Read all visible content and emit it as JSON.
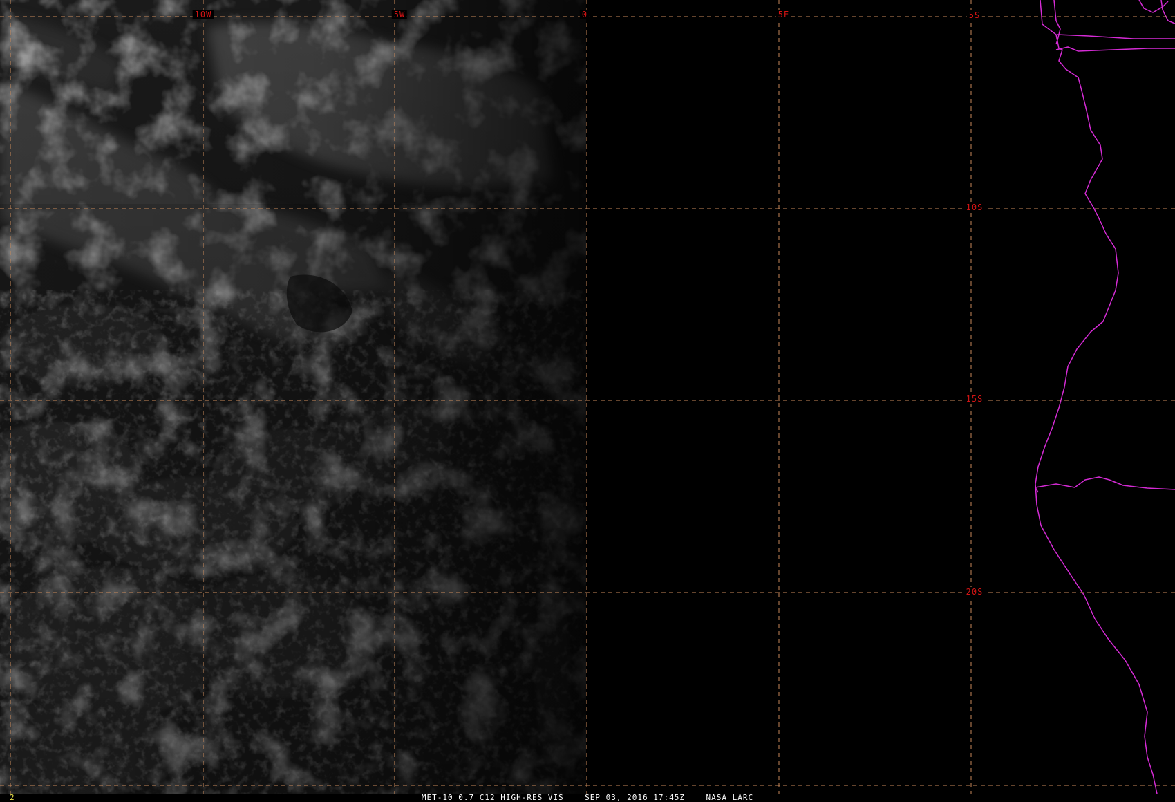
{
  "image": {
    "frame_number": "2",
    "caption": "MET-10 0.7 C12 HIGH-RES VIS    SEP 03, 2016 17:45Z    NASA LARC"
  },
  "graticule": {
    "longitude_labels": [
      "10W",
      "5W",
      "0",
      "5E"
    ],
    "latitude_labels": [
      "5S",
      "10S",
      "15S",
      "20S"
    ]
  },
  "colors": {
    "background": "#000000",
    "graticule_line": "#c8895a",
    "graticule_label": "#d41414",
    "coastline": "#d52bd5",
    "caption_text": "#ffffff",
    "frame_number_text": "#e8e04a",
    "cloud_field": "#8a8a8a"
  },
  "icons": {
    "graticule": "dashed-lat-lon-grid",
    "coastline": "coastline-outline"
  }
}
